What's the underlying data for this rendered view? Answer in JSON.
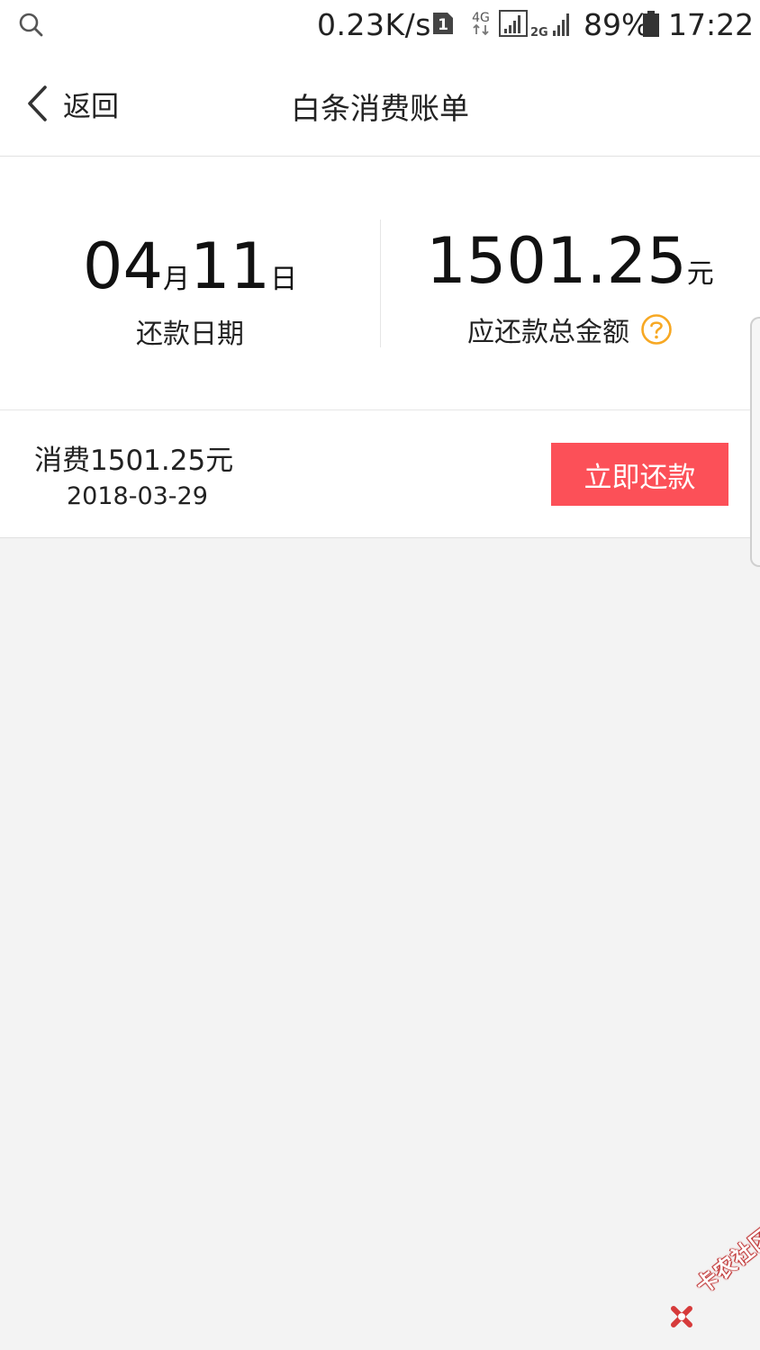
{
  "status_bar": {
    "net_speed": "0.23K/s",
    "sim_slot": "1",
    "net_type": "4G",
    "net_type_2": "2G",
    "battery": "89%",
    "time": "17:22"
  },
  "nav": {
    "back_label": "返回",
    "title": "白条消费账单"
  },
  "summary": {
    "month": "04",
    "month_unit": "月",
    "day": "11",
    "day_unit": "日",
    "due_label": "还款日期",
    "total_amount": "1501.25",
    "total_unit": "元",
    "total_label": "应还款总金额"
  },
  "bill": {
    "title": "消费1501.25元",
    "date": "2018-03-29",
    "pay_label": "立即还款"
  },
  "watermark": {
    "text": "卡农社区"
  },
  "colors": {
    "accent": "#fc5058",
    "help_icon": "#f7a823",
    "background": "#f3f3f3"
  }
}
